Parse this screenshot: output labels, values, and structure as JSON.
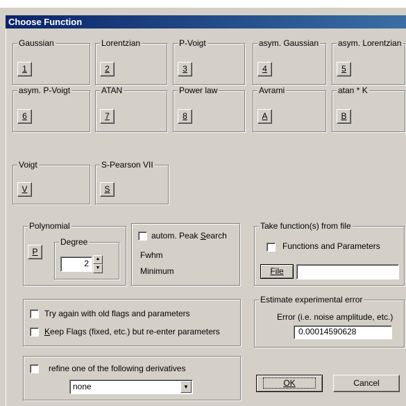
{
  "window": {
    "title": "Choose Function"
  },
  "functions": [
    {
      "label": "Gaussian",
      "key": "1"
    },
    {
      "label": "Lorentzian",
      "key": "2"
    },
    {
      "label": "P-Voigt",
      "key": "3"
    },
    {
      "label": "asym. Gaussian",
      "key": "4"
    },
    {
      "label": "asym. Lorentzian",
      "key": "5"
    },
    {
      "label": "asym. P-Voigt",
      "key": "6"
    },
    {
      "label": "ATAN",
      "key": "7"
    },
    {
      "label": "Power law",
      "key": "8"
    },
    {
      "label": "Avrami",
      "key": "A"
    },
    {
      "label": "atan * K",
      "key": "B"
    },
    {
      "label": "Voigt",
      "key": "V"
    },
    {
      "label": "S-Pearson VII",
      "key": "S"
    }
  ],
  "polynomial": {
    "title": "Polynomial",
    "button": "P",
    "degree_label": "Degree",
    "degree_value": "2"
  },
  "peak_search": {
    "label_prefix": "autom. Peak ",
    "label_ul": "S",
    "label_suffix": "earch",
    "fwhm": "Fwhm",
    "minimum": "Minimum"
  },
  "take_file": {
    "title": "Take function(s) from file",
    "label": "Functions and Parameters",
    "file_button": "File",
    "file_value": ""
  },
  "options": {
    "try_again": "Try again with old flags and parameters",
    "keep_flags_ul": "K",
    "keep_flags": "eep Flags (fixed, etc.) but re-enter parameters"
  },
  "derivatives": {
    "label": "refine one of the following derivatives",
    "selected": "none"
  },
  "error": {
    "title": "Estimate experimental error",
    "label": "Error (i.e. noise amplitude, etc.)",
    "value": "0.00014590628"
  },
  "buttons": {
    "ok": "OK",
    "cancel": "Cancel"
  }
}
